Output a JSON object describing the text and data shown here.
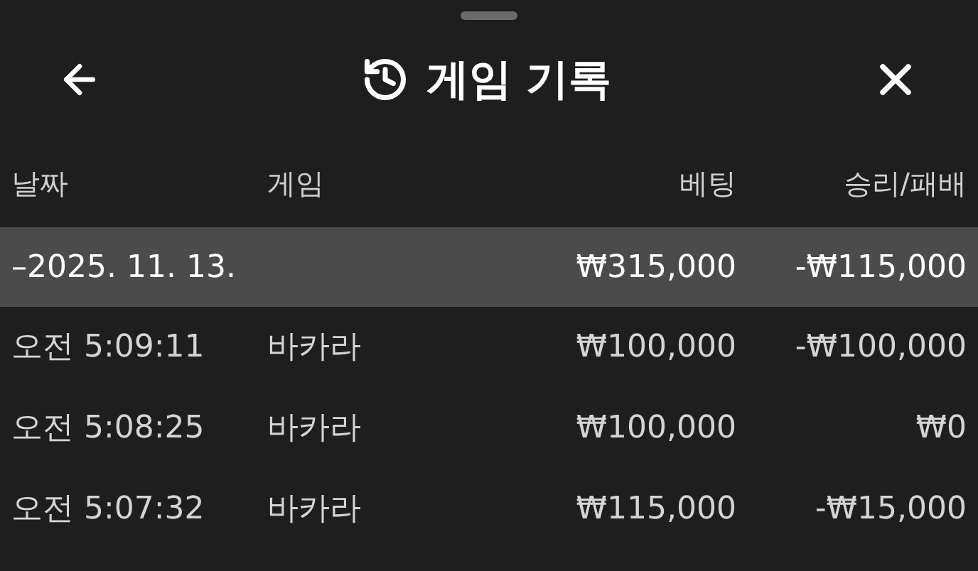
{
  "header": {
    "title": "게임 기록"
  },
  "columns": [
    "날짜",
    "게임",
    "베팅",
    "승리/패배"
  ],
  "group": {
    "date": "–2025. 11. 13.",
    "bet": "₩315,000",
    "result": "-₩115,000",
    "selected": true
  },
  "rows": [
    {
      "time": "오전 5:09:11",
      "game": "바카라",
      "bet": "₩100,000",
      "result": "-₩100,000"
    },
    {
      "time": "오전 5:08:25",
      "game": "바카라",
      "bet": "₩100,000",
      "result": "₩0"
    },
    {
      "time": "오전 5:07:32",
      "game": "바카라",
      "bet": "₩115,000",
      "result": "-₩15,000"
    }
  ]
}
